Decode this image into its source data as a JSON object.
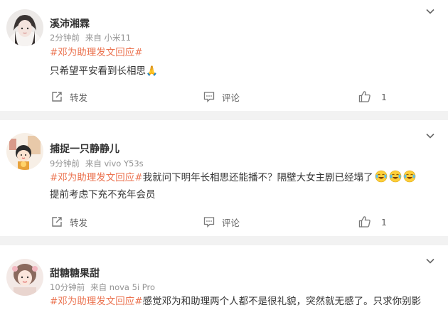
{
  "posts": [
    {
      "username": "溪沛湘霖",
      "time": "2分钟前",
      "source": "来自 小米11",
      "hashtag": "#邓为助理发文回应#",
      "body_lines": [
        "只希望平安看到长相思🙏"
      ],
      "share_label": "转发",
      "comment_label": "评论",
      "like_count": "1"
    },
    {
      "username": "捕捉一只静静儿",
      "time": "9分钟前",
      "source": "来自 vivo Y53s",
      "hashtag": "#邓为助理发文回应#",
      "body_first": "我就问下明年长相思还能播不？隔壁大女主剧已经塌了",
      "body_second": "提前考虑下充不充年会员",
      "emoji_icons": [
        "laugh-cry-icon",
        "laugh-cry-icon",
        "laugh-cry-icon"
      ],
      "share_label": "转发",
      "comment_label": "评论",
      "like_count": "1"
    },
    {
      "username": "甜糖糖果甜",
      "time": "10分钟前",
      "source": "来自 nova 5i Pro",
      "hashtag": "#邓为助理发文回应#",
      "body_first": "感觉邓为和助理两个人都不是很礼貌，突然就无感了。只求你别影"
    }
  ],
  "colors": {
    "hashtag": "#eb7350",
    "meta": "#939393",
    "separator": "#f2f2f2"
  }
}
